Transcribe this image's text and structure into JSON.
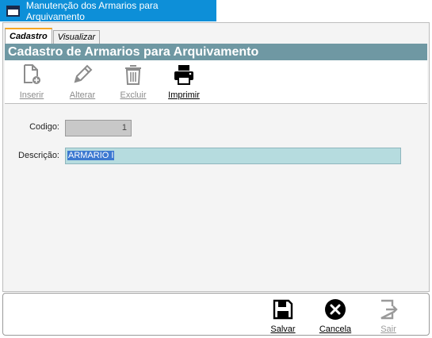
{
  "window": {
    "title": "Manutenção dos Armarios para Arquivamento"
  },
  "tabs": [
    {
      "label": "Cadastro",
      "active": true
    },
    {
      "label": "Visualizar",
      "active": false
    }
  ],
  "section_title": "Cadastro de Armarios para Arquivamento",
  "toolbar": {
    "inserir": {
      "label": "Inserir",
      "icon": "new-document-icon",
      "enabled": false
    },
    "alterar": {
      "label": "Alterar",
      "icon": "pencil-icon",
      "enabled": false
    },
    "excluir": {
      "label": "Excluir",
      "icon": "trash-icon",
      "enabled": false
    },
    "imprimir": {
      "label": "Imprimir",
      "icon": "printer-icon",
      "enabled": true
    }
  },
  "form": {
    "codigo_label": "Codigo:",
    "codigo_value": "1",
    "descricao_label": "Descrição:",
    "descricao_value": "ARMARIO I"
  },
  "actions": {
    "salvar": {
      "label": "Salvar",
      "icon": "floppy-disk-icon",
      "enabled": true
    },
    "cancela": {
      "label": "Cancela",
      "icon": "cancel-circle-icon",
      "enabled": true
    },
    "sair": {
      "label": "Sair",
      "icon": "exit-door-icon",
      "enabled": false
    }
  },
  "colors": {
    "titlebar": "#0d8fd8",
    "section_header": "#6f98a3",
    "active_tab_accent": "#f6a623",
    "description_field": "#b6dcdf",
    "selection": "#3c79d1"
  }
}
